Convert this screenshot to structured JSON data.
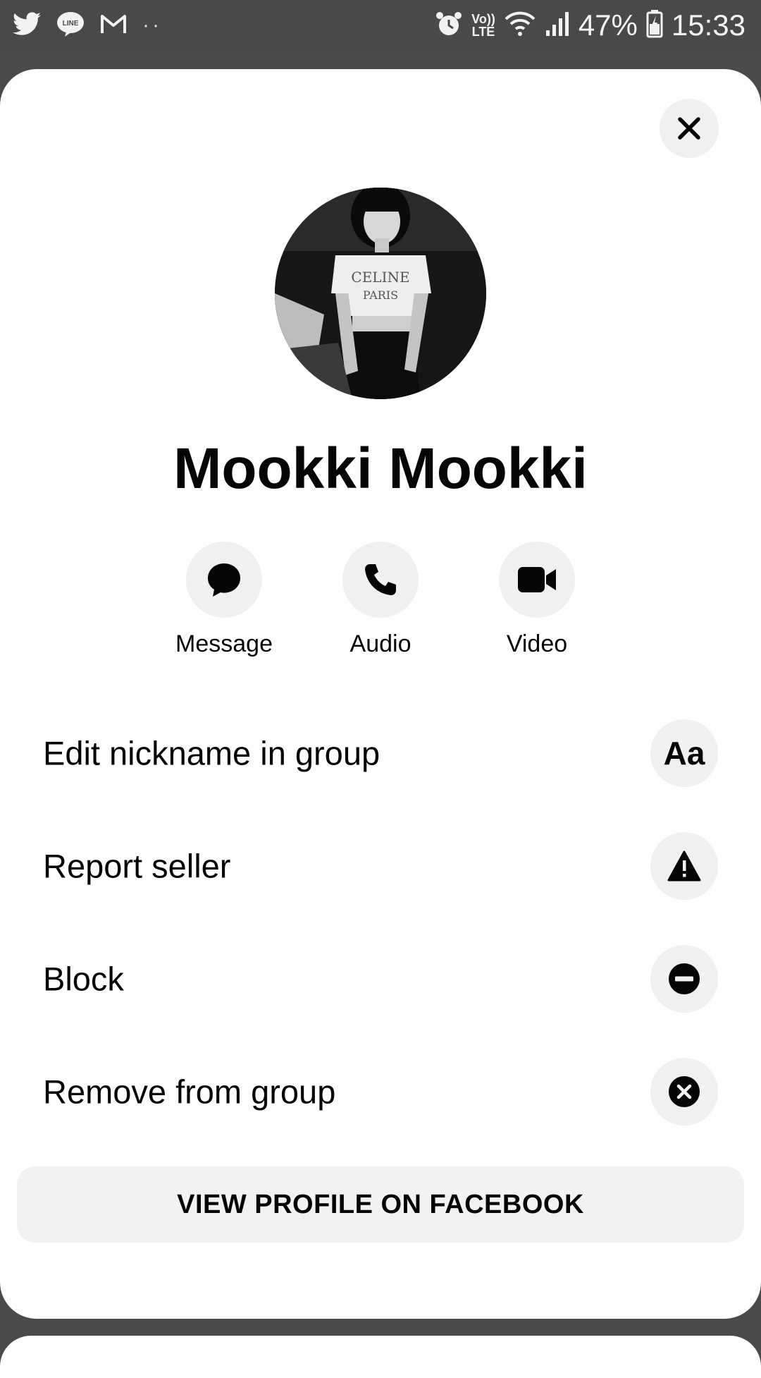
{
  "status_bar": {
    "icons": [
      "twitter-icon",
      "line-icon",
      "gmail-icon",
      "more-dots-icon",
      "alarm-icon",
      "volte-icon",
      "wifi-icon",
      "signal-icon",
      "battery-icon"
    ],
    "volte_top": "Vo))",
    "volte_bottom": "LTE",
    "battery": "47%",
    "time": "15:33"
  },
  "profile": {
    "name": "Mookki Mookki"
  },
  "actions": [
    {
      "label": "Message",
      "icon": "message-icon"
    },
    {
      "label": "Audio",
      "icon": "phone-icon"
    },
    {
      "label": "Video",
      "icon": "video-icon"
    }
  ],
  "options": [
    {
      "label": "Edit nickname in group",
      "icon": "text-aa-icon",
      "icon_text": "Aa"
    },
    {
      "label": "Report seller",
      "icon": "warning-icon"
    },
    {
      "label": "Block",
      "icon": "block-icon"
    },
    {
      "label": "Remove from group",
      "icon": "remove-circle-icon"
    }
  ],
  "view_profile_label": "VIEW PROFILE ON FACEBOOK",
  "colors": {
    "status_bar_bg": "#494949",
    "sheet_bg": "#ffffff",
    "icon_circle_bg": "#f0f0f0",
    "text": "#050505"
  }
}
